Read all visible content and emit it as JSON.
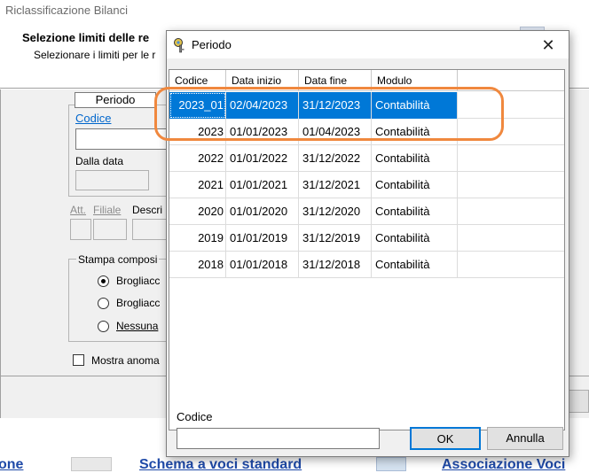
{
  "background": {
    "title": "Riclassificazione Bilanci",
    "heading": "Selezione limiti delle re",
    "subheading": "Selezionare i limiti per le r",
    "tab_label": "Periodo",
    "codice_link": "Codice",
    "dalla_data_label": "Dalla data",
    "att_label": "Att.",
    "filiale_label": "Filiale",
    "descr_label": "Descri",
    "stampa_group_label": "Stampa composi",
    "radio_options": [
      {
        "label": "Brogliacc",
        "checked": true
      },
      {
        "label": "Brogliacc",
        "checked": false
      },
      {
        "label": "Nessuna",
        "checked": false
      }
    ],
    "mostra_checkbox_label": "Mostra anoma",
    "footer_links": {
      "left": "one",
      "middle": "Schema a voci standard",
      "right": "Associazione Voci"
    }
  },
  "dialog": {
    "title": "Periodo",
    "close_symbol": "✕",
    "columns": {
      "codice": "Codice",
      "data_inizio": "Data inizio",
      "data_fine": "Data fine",
      "modulo": "Modulo"
    },
    "rows": [
      {
        "codice": "2023_01",
        "data_inizio": "02/04/2023",
        "data_fine": "31/12/2023",
        "modulo": "Contabilità",
        "selected": true
      },
      {
        "codice": "2023",
        "data_inizio": "01/01/2023",
        "data_fine": "01/04/2023",
        "modulo": "Contabilità",
        "selected": false
      },
      {
        "codice": "2022",
        "data_inizio": "01/01/2022",
        "data_fine": "31/12/2022",
        "modulo": "Contabilità",
        "selected": false
      },
      {
        "codice": "2021",
        "data_inizio": "01/01/2021",
        "data_fine": "31/12/2021",
        "modulo": "Contabilità",
        "selected": false
      },
      {
        "codice": "2020",
        "data_inizio": "01/01/2020",
        "data_fine": "31/12/2020",
        "modulo": "Contabilità",
        "selected": false
      },
      {
        "codice": "2019",
        "data_inizio": "01/01/2019",
        "data_fine": "31/12/2019",
        "modulo": "Contabilità",
        "selected": false
      },
      {
        "codice": "2018",
        "data_inizio": "01/01/2018",
        "data_fine": "31/12/2018",
        "modulo": "Contabilità",
        "selected": false
      }
    ],
    "codice_label": "Codice",
    "codice_value": "",
    "ok_label": "OK",
    "cancel_label": "Annulla"
  },
  "colors": {
    "selection": "#0078d7",
    "annotation_highlight": "#f0883e",
    "link": "#0066cc"
  }
}
